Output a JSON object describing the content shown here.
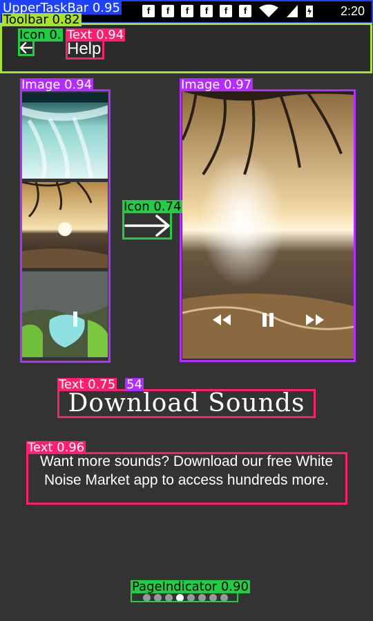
{
  "status_bar": {
    "time": "2:20"
  },
  "toolbar": {
    "title": "Help"
  },
  "content": {
    "heading": "Download Sounds",
    "description": "Want more sounds? Download our free White Noise Market app to access hundreds more."
  },
  "page_indicator": {
    "count": 8,
    "active_index": 3
  },
  "detections": [
    {
      "label": "UpperTaskBar 0.95",
      "color": "#1e40ff"
    },
    {
      "label": "Toolbar 0.82",
      "color": "#a6e22e"
    },
    {
      "label": "Icon 0.",
      "color": "#22cc44"
    },
    {
      "label": "Text 0.94",
      "color": "#ff1f6f"
    },
    {
      "label": "Image 0.94",
      "color": "#b42cff"
    },
    {
      "label": "Image 0.97",
      "color": "#b42cff"
    },
    {
      "label": "Icon 0.74",
      "color": "#22cc44"
    },
    {
      "label": "Text 0.75",
      "color": "#ff1f6f"
    },
    {
      "label": "54",
      "color": "#b42cff"
    },
    {
      "label": "Text 0.96",
      "color": "#ff1f6f"
    },
    {
      "label": "PageIndicator 0.90",
      "color": "#22cc44"
    }
  ]
}
